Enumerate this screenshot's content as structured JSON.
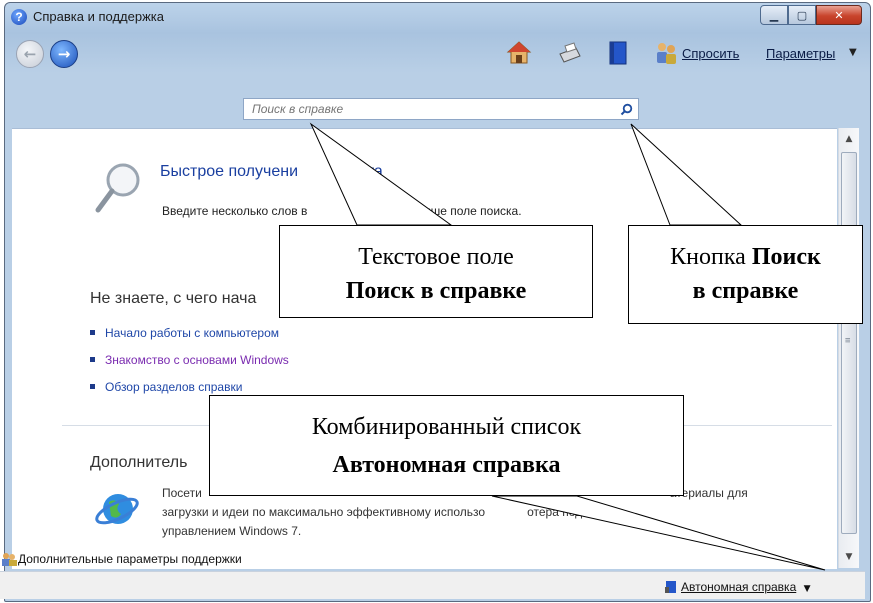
{
  "window": {
    "title": "Справка и поддержка"
  },
  "toolbar": {
    "ask_label": "Спросить",
    "params_label": "Параметры",
    "icons": [
      "home-icon",
      "printer-icon",
      "book-icon",
      "people-icon"
    ]
  },
  "search": {
    "placeholder": "Поиск в справке"
  },
  "content": {
    "quick_title": "Быстрое получени",
    "quick_title_tail": "вета",
    "quick_desc_a": "Введите несколько слов в",
    "quick_desc_b": "женном выше поле поиска.",
    "unknown_heading": "Не знаете, с чего нача",
    "links": [
      {
        "label": "Начало работы с компьютером",
        "color": "#1f47a8"
      },
      {
        "label": "Знакомство с основами Windows",
        "color": "#7a2bb0"
      },
      {
        "label": "Обзор разделов справки",
        "color": "#1f47a8"
      }
    ],
    "extra_heading": "Дополнитель",
    "extra_text_a": "Посети",
    "extra_text_b": "атериалы для",
    "extra_text_c": "загрузки и идеи по максимально эффективному использо",
    "extra_text_d": "отера под",
    "extra_text_e": "управлением Windows 7."
  },
  "status": {
    "more_options": "Дополнительные параметры поддержки",
    "offline_help": "Автономная справка"
  },
  "callouts": {
    "text_field_line1": "Текстовое поле",
    "text_field_line2": "Поиск в справке",
    "search_button_line1": "Кнопка ",
    "search_button_line1_bold": "Поиск",
    "search_button_line2": "в справке",
    "combo_line1": "Комбинированный список",
    "combo_line2": "Автономная справка"
  },
  "colors": {
    "link_blue": "#1f47a8",
    "link_purple": "#7a2bb0",
    "title_blue": "#1a3fa0"
  }
}
